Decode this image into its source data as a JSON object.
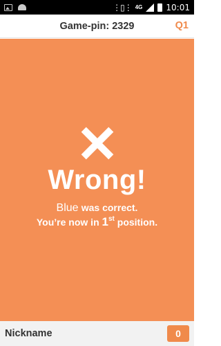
{
  "status_bar": {
    "network": "4G",
    "time": "10:01",
    "icons": [
      "image-icon",
      "android-icon",
      "vibrate-icon",
      "signal-icon",
      "battery-icon"
    ]
  },
  "header": {
    "game_pin": "Game-pin: 2329",
    "question": "Q1"
  },
  "result": {
    "title": "Wrong!",
    "correct_answer": "Blue",
    "correct_suffix": "was correct.",
    "position_prefix": "You’re now in",
    "position_number": "1",
    "position_ordinal": "st",
    "position_suffix": "position.",
    "icon": "x-icon"
  },
  "footer": {
    "nickname": "Nickname",
    "score": "0"
  },
  "colors": {
    "panel": "#f48f55",
    "accent": "#f08a4b",
    "status_bar": "#000000"
  }
}
